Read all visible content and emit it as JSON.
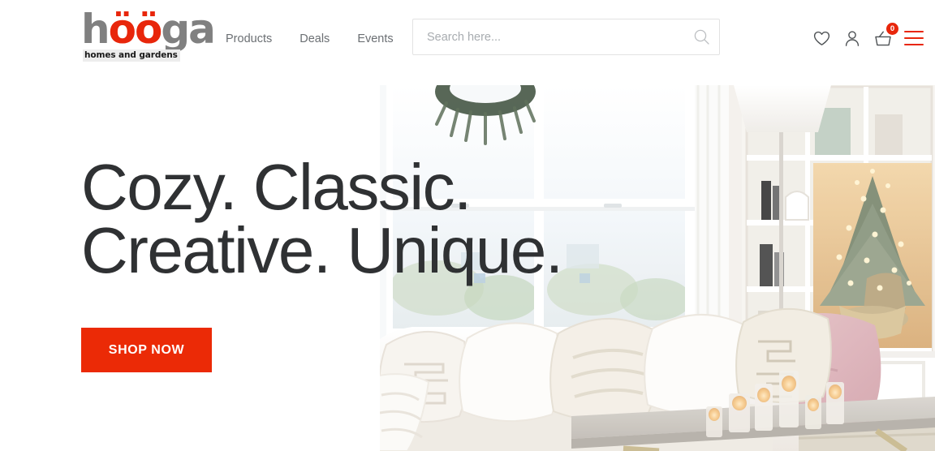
{
  "brand": {
    "name_part1": "h",
    "name_oo": "öö",
    "name_part2": "ga",
    "tagline": "homes and gardens"
  },
  "nav": {
    "items": [
      {
        "label": "Products"
      },
      {
        "label": "Deals"
      },
      {
        "label": "Events"
      }
    ]
  },
  "search": {
    "value": "",
    "placeholder": "Search here...",
    "icon": "search-icon"
  },
  "header_icons": {
    "wishlist": {
      "icon": "heart-icon",
      "label": "Wishlist"
    },
    "account": {
      "icon": "user-icon",
      "label": "Account"
    },
    "cart": {
      "icon": "basket-icon",
      "label": "Cart",
      "count": "0"
    },
    "menu": {
      "icon": "hamburger-menu-icon",
      "label": "Menu"
    }
  },
  "hero": {
    "title_line1": "Cozy. Classic.",
    "title_line2": "Creative. Unique.",
    "cta_label": "SHOP NOW",
    "image_alt": "Bright living room with white sofa, knit pillows, pink throw blanket, lit candles on coffee table and a decorated lit tree by the window"
  },
  "colors": {
    "accent_red": "#EB2A06",
    "logo_gray": "#808080",
    "heading": "#2f3133",
    "nav_text": "#6b6f73",
    "placeholder": "#a8acb0",
    "border": "#e2e2e2"
  }
}
